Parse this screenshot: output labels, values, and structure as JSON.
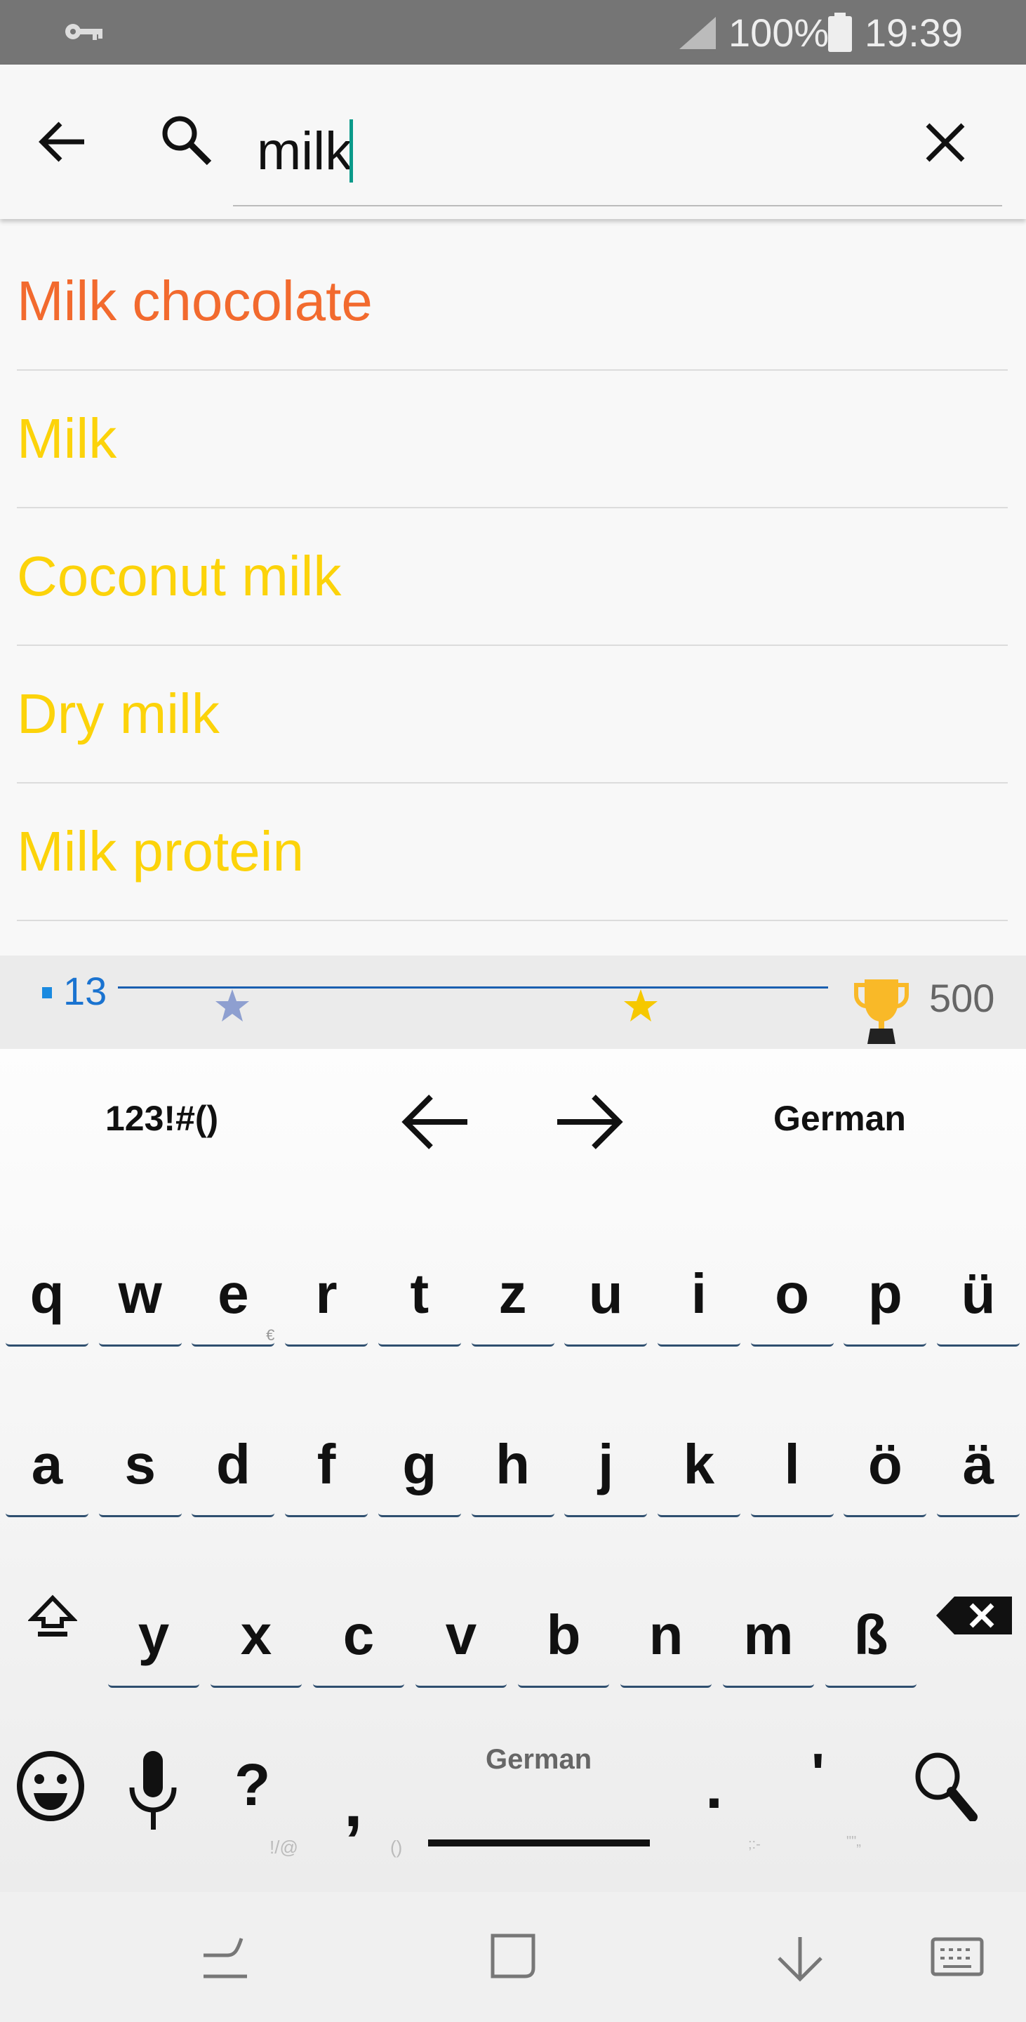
{
  "status_bar": {
    "battery": "100%",
    "time": "19:39",
    "icons": [
      "key-icon",
      "signal-icon",
      "battery-icon"
    ]
  },
  "search": {
    "value": "milk",
    "back_icon": "arrow-left-icon",
    "search_icon": "search-icon",
    "clear_icon": "close-icon"
  },
  "results": [
    {
      "label": "Milk chocolate",
      "color": "#f26a2e"
    },
    {
      "label": "Milk",
      "color": "#fcd30a"
    },
    {
      "label": "Coconut milk",
      "color": "#fcd30a"
    },
    {
      "label": "Dry milk",
      "color": "#fcd30a"
    },
    {
      "label": "Milk protein",
      "color": "#fcd30a"
    }
  ],
  "progress": {
    "current": "13",
    "goal": "500",
    "value": 13,
    "max": 500,
    "accent": "#1a73d0"
  },
  "keyboard": {
    "top": {
      "symbols": "123!#()",
      "language": "German"
    },
    "row1": [
      "q",
      "w",
      "e",
      "r",
      "t",
      "z",
      "u",
      "i",
      "o",
      "p",
      "ü"
    ],
    "row1_sub": {
      "e": "€"
    },
    "row2": [
      "a",
      "s",
      "d",
      "f",
      "g",
      "h",
      "j",
      "k",
      "l",
      "ö",
      "ä"
    ],
    "row3": [
      "y",
      "x",
      "c",
      "v",
      "b",
      "n",
      "m",
      "ß"
    ],
    "bottom": {
      "question": "?",
      "comma": ",",
      "space_label": "German",
      "period": ".",
      "apostrophe": "'",
      "hints": [
        "!/@",
        "()",
        ";:-",
        "\"\"„"
      ]
    }
  }
}
